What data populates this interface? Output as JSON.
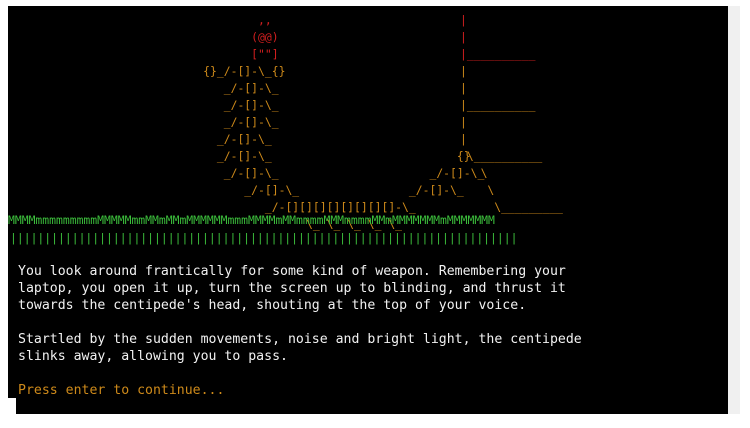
{
  "scene": {
    "head_lines": [
      "                                   ,,",
      "                                  (@@)",
      "                                  [\"\"]"
    ],
    "body_lines": [
      "                           {}_/-[]-\\_{}",
      "                              _/-[]-\\_",
      "                              _/-[]-\\_",
      "                              _/-[]-\\_",
      "                             _/-[]-\\_",
      "                             _/-[]-\\_                           {}",
      "                              _/-[]-\\_                      _/-[]-\\_",
      "                                 _/-[]-\\_                _/-[]-\\_",
      "                                    _/-[][][][][][][][]-\\_",
      "                                          \\_ \\_ \\_ \\_ \\_"
    ],
    "wall_lines": [
      "|",
      "|",
      "|__________",
      "|",
      "|",
      "|__________",
      "|",
      "|",
      " \\__________",
      "   \\",
      "    \\",
      "     \\_________"
    ],
    "grass_line": "MMMMmmmmmmmmmMMMMMmmMMmMMmMMMMMMmmmMMMMmMMmmmmMMMmmmmMMmMMMMMMMmMMMMMMM",
    "fence_line": "||||||||||||||||||||||||||||||||||||||||||||||||||||||||||||||||||||||||||"
  },
  "story": {
    "paragraph1": [
      "You look around frantically for some kind of weapon. Remembering your",
      "laptop, you open it up, turn the screen up to blinding, and thrust it",
      "towards the centipede's head, shouting at the top of your voice."
    ],
    "paragraph2": [
      "Startled by the sudden movements, noise and bright light, the centipede",
      "slinks away, allowing you to pass."
    ]
  },
  "prompt": "Press enter to continue...",
  "colors": {
    "background": "#000000",
    "text": "#f2f2f2",
    "head": "#d21f1f",
    "body": "#ce8a1a",
    "grass": "#3cbf3c"
  }
}
